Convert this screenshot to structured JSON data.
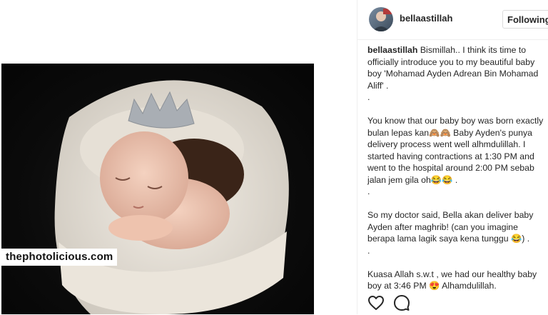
{
  "post": {
    "watermark": "thephotolicious.com",
    "username": "bellaastillah",
    "follow_label": "Following",
    "caption": {
      "user": "bellaastillah",
      "p1": "Bismillah.. I think its time to officially introduce you to my beautiful baby boy 'Mohamad Ayden Adrean Bin Mohamad Aliff' .",
      "dot1": ".",
      "p2": "You know that our baby boy was born exactly bulan lepas kan🙈🙈 Baby Ayden's punya delivery process went well alhmdulillah. I started having contractions at 1:30 PM and went to the hospital around 2:00 PM sebab jalan jem gila oh😂😂 .",
      "dot2": ".",
      "p3": "So my doctor said, Bella akan deliver baby Ayden after maghrib! (can you imagine berapa lama lagik saya kena tunggu 😂) .",
      "dot3": ".",
      "p4": "Kuasa Allah s.w.t , we had our healthy baby boy at 3:46 PM 😍 Alhamdulillah."
    },
    "icons": {
      "like": "heart-icon",
      "comment": "comment-icon"
    }
  }
}
